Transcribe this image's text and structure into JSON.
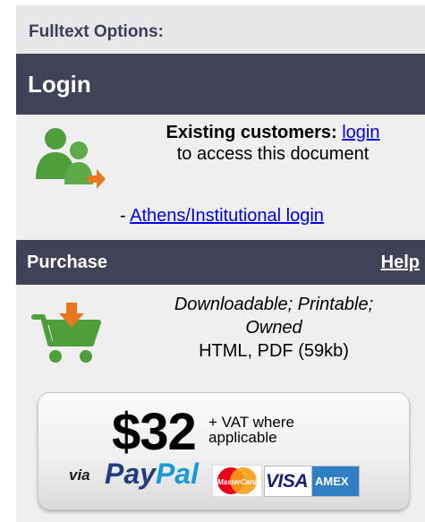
{
  "fulltext": {
    "title": "Fulltext Options:"
  },
  "login": {
    "title": "Login",
    "existing_label": "Existing customers:",
    "login_link": "login",
    "access_text": "to access this document",
    "athens_prefix": "- ",
    "athens_link": "Athens/Institutional login"
  },
  "purchase": {
    "title": "Purchase",
    "help_link": "Help",
    "format_line1": "Downloadable; Printable;",
    "format_line2": "Owned",
    "file_info": "HTML, PDF (59kb)",
    "price": "$32",
    "vat_line1": "+ VAT where",
    "vat_line2": "applicable",
    "via": "via",
    "paypal_pay": "Pay",
    "paypal_pal": "Pal",
    "mastercard_text": "MasterCard",
    "visa_text": "VISA",
    "amex_text": "AMEX"
  },
  "colors": {
    "bar": "#404257",
    "icon_green": "#4f9e3c",
    "icon_orange": "#e6771e",
    "link": "#0000ee"
  }
}
